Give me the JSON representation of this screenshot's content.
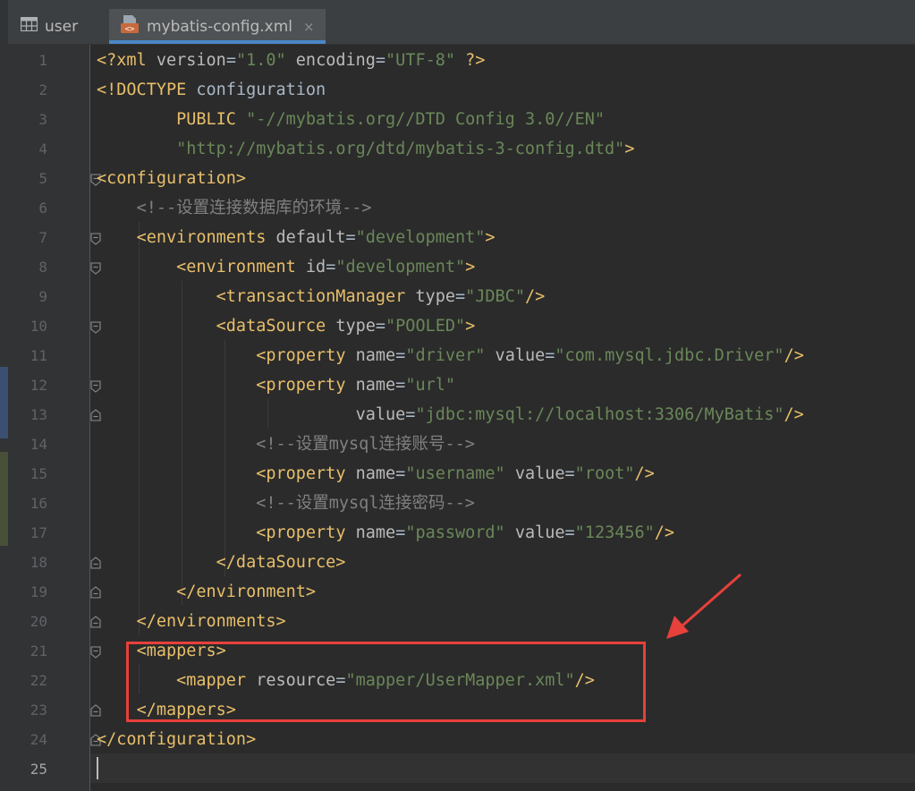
{
  "tabs": [
    {
      "label": "user",
      "icon": "table-icon",
      "active": false
    },
    {
      "label": "mybatis-config.xml",
      "icon": "xml-file-icon",
      "active": true,
      "close": "×"
    }
  ],
  "line_numbers": [
    "1",
    "2",
    "3",
    "4",
    "5",
    "6",
    "7",
    "8",
    "9",
    "10",
    "11",
    "12",
    "13",
    "14",
    "15",
    "16",
    "17",
    "18",
    "19",
    "20",
    "21",
    "22",
    "23",
    "24",
    "25"
  ],
  "current_line": "25",
  "code": {
    "l1": {
      "open": "<?",
      "tag": "xml",
      "a1": " version",
      "eq1": "=",
      "v1": "\"1.0\"",
      "a2": " encoding",
      "eq2": "=",
      "v2": "\"UTF-8\"",
      "close": " ?>"
    },
    "l2": {
      "open": "<!DOCTYPE",
      "rest": " configuration"
    },
    "l3": {
      "kw": "PUBLIC",
      "str": " \"-//mybatis.org//DTD Config 3.0//EN\""
    },
    "l4": {
      "str": "\"http://mybatis.org/dtd/mybatis-3-config.dtd\"",
      "close": ">"
    },
    "l5": {
      "open": "<configuration>"
    },
    "l6": {
      "comment": "<!--设置连接数据库的环境-->"
    },
    "l7": {
      "open": "<environments",
      "a1": " default",
      "eq1": "=",
      "v1": "\"development\"",
      "close": ">"
    },
    "l8": {
      "open": "<environment",
      "a1": " id",
      "eq1": "=",
      "v1": "\"development\"",
      "close": ">"
    },
    "l9": {
      "open": "<transactionManager",
      "a1": " type",
      "eq1": "=",
      "v1": "\"JDBC\"",
      "close": "/>"
    },
    "l10": {
      "open": "<dataSource",
      "a1": " type",
      "eq1": "=",
      "v1": "\"POOLED\"",
      "close": ">"
    },
    "l11": {
      "open": "<property",
      "a1": " name",
      "eq1": "=",
      "v1": "\"driver\"",
      "a2": " value",
      "eq2": "=",
      "v2": "\"com.mysql.jdbc.Driver\"",
      "close": "/>"
    },
    "l12": {
      "open": "<property",
      "a1": " name",
      "eq1": "=",
      "v1": "\"url\""
    },
    "l13": {
      "a1": "value",
      "eq1": "=",
      "v1": "\"jdbc:mysql://localhost:3306/MyBatis\"",
      "close": "/>"
    },
    "l14": {
      "comment": "<!--设置mysql连接账号-->"
    },
    "l15": {
      "open": "<property",
      "a1": " name",
      "eq1": "=",
      "v1": "\"username\"",
      "a2": " value",
      "eq2": "=",
      "v2": "\"root\"",
      "close": "/>"
    },
    "l16": {
      "comment": "<!--设置mysql连接密码-->"
    },
    "l17": {
      "open": "<property",
      "a1": " name",
      "eq1": "=",
      "v1": "\"password\"",
      "a2": " value",
      "eq2": "=",
      "v2": "\"123456\"",
      "close": "/>"
    },
    "l18": {
      "open": "</dataSource>"
    },
    "l19": {
      "open": "</environment>"
    },
    "l20": {
      "open": "</environments>"
    },
    "l21": {
      "open": "<mappers>"
    },
    "l22": {
      "open": "<mapper",
      "a1": " resource",
      "eq1": "=",
      "v1": "\"mapper/UserMapper.xml\"",
      "close": "/>"
    },
    "l23": {
      "open": "</mappers>"
    },
    "l24": {
      "open": "</configuration>"
    }
  },
  "colors": {
    "tag": "#e8bf6a",
    "attribute": "#bababa",
    "value": "#6a8759",
    "comment": "#808080",
    "keyword": "#cc7832",
    "plain": "#a9b7c6",
    "annotation": "#e8403b",
    "tab_underline": "#4a88c7"
  }
}
